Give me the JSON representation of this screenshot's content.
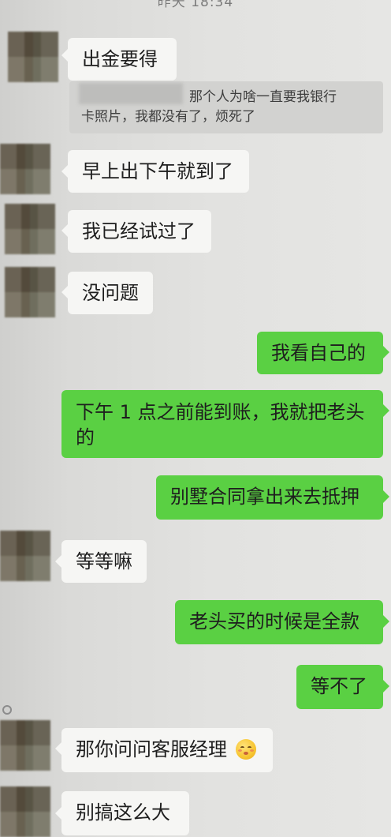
{
  "status_bar": {
    "time": "昨天 18:34"
  },
  "chat": {
    "messages": [
      {
        "side": "left",
        "text": "出金要得"
      },
      {
        "side": "quote",
        "text_line1": "那个人为啥一直要我银行",
        "text_line2": "卡照片，我都没有了，烦死了"
      },
      {
        "side": "left",
        "text": "早上出下午就到了"
      },
      {
        "side": "left",
        "text": "我已经试过了"
      },
      {
        "side": "left",
        "text": "没问题"
      },
      {
        "side": "right",
        "text": "我看自己的"
      },
      {
        "side": "right",
        "text_line1": "下午 1 点之前能到账，我就把老头",
        "text_line2": "的"
      },
      {
        "side": "right",
        "text": "别墅合同拿出来去抵押"
      },
      {
        "side": "left",
        "text": "等等嘛"
      },
      {
        "side": "right",
        "text": "老头买的时候是全款"
      },
      {
        "side": "right",
        "text": "等不了"
      },
      {
        "side": "left",
        "text": "那你问问客服经理",
        "emoji": "pouting-kiss-emoji"
      },
      {
        "side": "left",
        "text": "别搞这么大"
      }
    ]
  }
}
